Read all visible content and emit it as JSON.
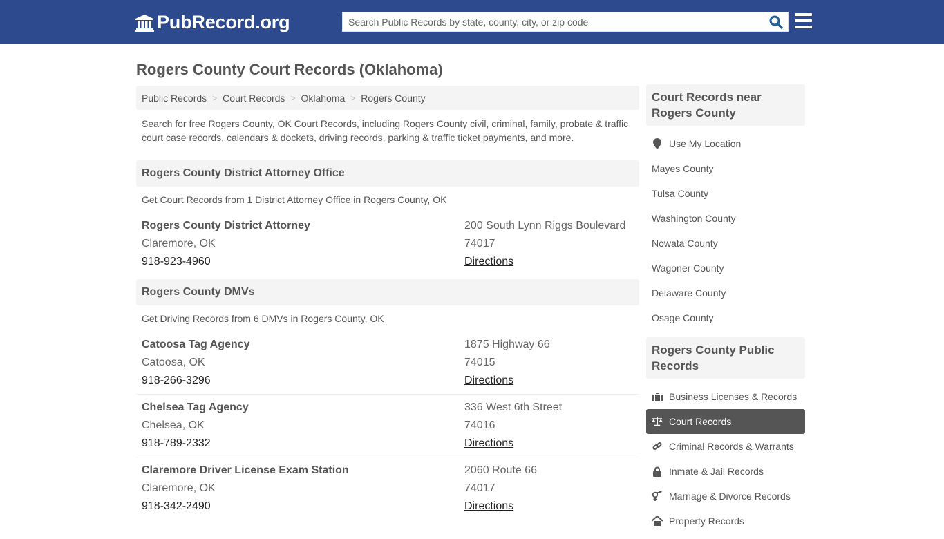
{
  "header": {
    "logo_text": "PubRecord.org",
    "search_placeholder": "Search Public Records by state, county, city, or zip code",
    "search_value": ""
  },
  "page_title": "Rogers County Court Records (Oklahoma)",
  "breadcrumb": [
    "Public Records",
    "Court Records",
    "Oklahoma",
    "Rogers County"
  ],
  "breadcrumb_separator": ">",
  "intro": "Search for free Rogers County, OK Court Records, including Rogers County civil, criminal, family, probate & traffic court case records, calendars & dockets, driving records, parking & traffic ticket payments, and more.",
  "sections": [
    {
      "title": "Rogers County District Attorney Office",
      "subtitle": "Get Court Records from 1 District Attorney Office in Rogers County, OK",
      "entries": [
        {
          "name": "Rogers County District Attorney",
          "city": "Claremore, OK",
          "phone": "918-923-4960",
          "address": "200 South Lynn Riggs Boulevard",
          "zip": "74017",
          "link": "Directions"
        }
      ]
    },
    {
      "title": "Rogers County DMVs",
      "subtitle": "Get Driving Records from 6 DMVs in Rogers County, OK",
      "entries": [
        {
          "name": "Catoosa Tag Agency",
          "city": "Catoosa, OK",
          "phone": "918-266-3296",
          "address": "1875 Highway 66",
          "zip": "74015",
          "link": "Directions"
        },
        {
          "name": "Chelsea Tag Agency",
          "city": "Chelsea, OK",
          "phone": "918-789-2332",
          "address": "336 West 6th Street",
          "zip": "74016",
          "link": "Directions"
        },
        {
          "name": "Claremore Driver License Exam Station",
          "city": "Claremore, OK",
          "phone": "918-342-2490",
          "address": "2060 Route 66",
          "zip": "74017",
          "link": "Directions"
        }
      ]
    }
  ],
  "sidebar": {
    "nearby": {
      "title": "Court Records near Rogers County",
      "use_location": "Use My Location",
      "items": [
        "Mayes County",
        "Tulsa County",
        "Washington County",
        "Nowata County",
        "Wagoner County",
        "Delaware County",
        "Osage County"
      ]
    },
    "public_records": {
      "title": "Rogers County Public Records",
      "items": [
        {
          "label": "Business Licenses & Records",
          "icon": "briefcase-icon",
          "active": false
        },
        {
          "label": "Court Records",
          "icon": "scales-icon",
          "active": true
        },
        {
          "label": "Criminal Records & Warrants",
          "icon": "chain-link-icon",
          "active": false
        },
        {
          "label": "Inmate & Jail Records",
          "icon": "lock-icon",
          "active": false
        },
        {
          "label": "Marriage & Divorce Records",
          "icon": "gender-icon",
          "active": false
        },
        {
          "label": "Property Records",
          "icon": "house-icon",
          "active": false
        }
      ]
    }
  },
  "colors": {
    "header_bg": "#2e4a8e",
    "search_icon": "#1f5fa0",
    "active_item_bg": "#555555",
    "panel_bg": "#f4f4f4"
  }
}
